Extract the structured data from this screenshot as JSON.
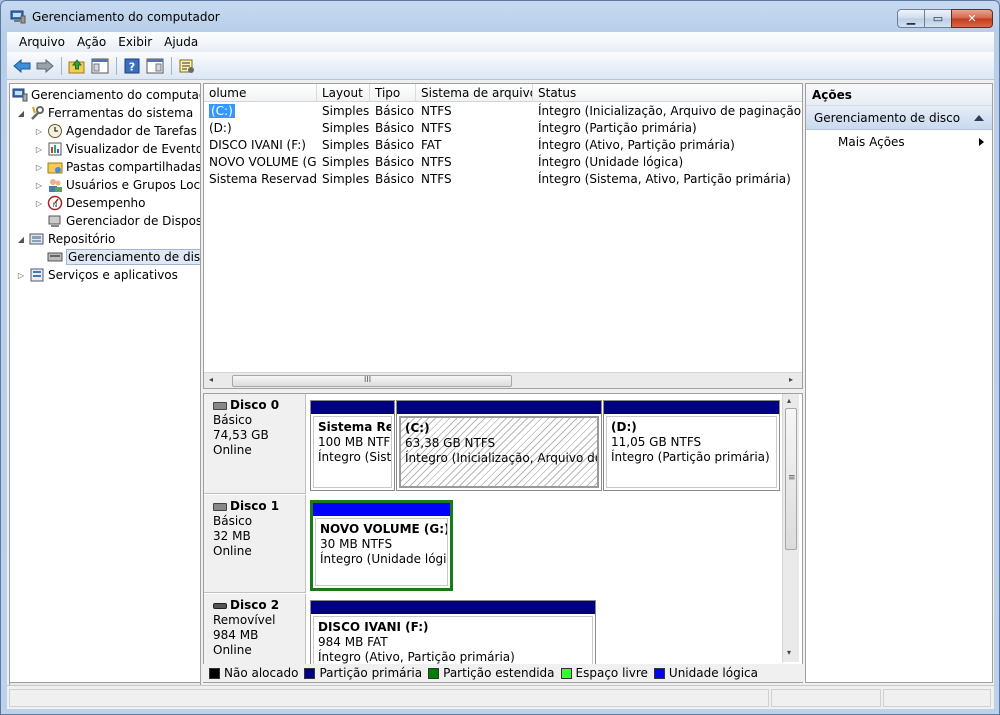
{
  "window": {
    "title": "Gerenciamento do computador"
  },
  "menu": [
    "Arquivo",
    "Ação",
    "Exibir",
    "Ajuda"
  ],
  "tree": [
    {
      "label": "Gerenciamento do computador",
      "level": 0,
      "exp": ""
    },
    {
      "label": "Ferramentas do sistema",
      "level": 1,
      "exp": "◢"
    },
    {
      "label": "Agendador de Tarefas",
      "level": 2,
      "exp": "▷"
    },
    {
      "label": "Visualizador de Eventos",
      "level": 2,
      "exp": "▷"
    },
    {
      "label": "Pastas compartilhadas",
      "level": 2,
      "exp": "▷"
    },
    {
      "label": "Usuários e Grupos Locais",
      "level": 2,
      "exp": "▷"
    },
    {
      "label": "Desempenho",
      "level": 2,
      "exp": "▷"
    },
    {
      "label": "Gerenciador de Dispositivos",
      "level": 2,
      "exp": ""
    },
    {
      "label": "Repositório",
      "level": 1,
      "exp": "◢"
    },
    {
      "label": "Gerenciamento de disco",
      "level": 2,
      "exp": "",
      "selected": true
    },
    {
      "label": "Serviços e aplicativos",
      "level": 1,
      "exp": "▷"
    }
  ],
  "volumes": {
    "headers": [
      "olume",
      "Layout",
      "Tipo",
      "Sistema de arquivos",
      "Status"
    ],
    "rows": [
      [
        "(C:)",
        "Simples",
        "Básico",
        "NTFS",
        "Íntegro (Inicialização, Arquivo de paginação, Despejo de memória, Partição primária)"
      ],
      [
        "(D:)",
        "Simples",
        "Básico",
        "NTFS",
        "Íntegro (Partição primária)"
      ],
      [
        "DISCO IVANI (F:)",
        "Simples",
        "Básico",
        "FAT",
        "Íntegro (Ativo, Partição primária)"
      ],
      [
        "NOVO VOLUME (G:)",
        "Simples",
        "Básico",
        "NTFS",
        "Íntegro (Unidade lógica)"
      ],
      [
        "Sistema Reservado",
        "Simples",
        "Básico",
        "NTFS",
        "Íntegro (Sistema, Ativo, Partição primária)"
      ]
    ]
  },
  "disks": [
    {
      "name": "Disco 0",
      "type": "Básico",
      "size": "74,53 GB",
      "status": "Online",
      "partitions": [
        {
          "name": "Sistema Reservado",
          "size": "100 MB NTFS",
          "status": "Íntegro (Sistema, Ativo, Partição primária)"
        },
        {
          "name": "(C:)",
          "size": "63,38 GB NTFS",
          "status": "Íntegro (Inicialização, Arquivo de paginação, Despejo de memória)"
        },
        {
          "name": "(D:)",
          "size": "11,05 GB NTFS",
          "status": "Íntegro (Partição primária)"
        }
      ]
    },
    {
      "name": "Disco 1",
      "type": "Básico",
      "size": "32 MB",
      "status": "Online",
      "partitions": [
        {
          "name": "NOVO VOLUME  (G:)",
          "size": "30 MB NTFS",
          "status": "Íntegro (Unidade lógica)"
        }
      ]
    },
    {
      "name": "Disco 2",
      "type": "Removível",
      "size": "984 MB",
      "status": "Online",
      "partitions": [
        {
          "name": "DISCO IVANI  (F:)",
          "size": "984 MB FAT",
          "status": "Íntegro (Ativo, Partição primária)"
        }
      ]
    }
  ],
  "legend": [
    {
      "label": "Não alocado",
      "color": "#000000"
    },
    {
      "label": "Partição primária",
      "color": "#000080"
    },
    {
      "label": "Partição estendida",
      "color": "#008000"
    },
    {
      "label": "Espaço livre",
      "color": "#33ff33"
    },
    {
      "label": "Unidade lógica",
      "color": "#0000ff"
    }
  ],
  "actions": {
    "header": "Ações",
    "section": "Gerenciamento de disco",
    "item": "Mais Ações"
  },
  "scroll_glyphs": {
    "left": "◂",
    "right": "▸",
    "up": "▴",
    "down": "▾",
    "grip": "III",
    "grip_v": "≡"
  }
}
